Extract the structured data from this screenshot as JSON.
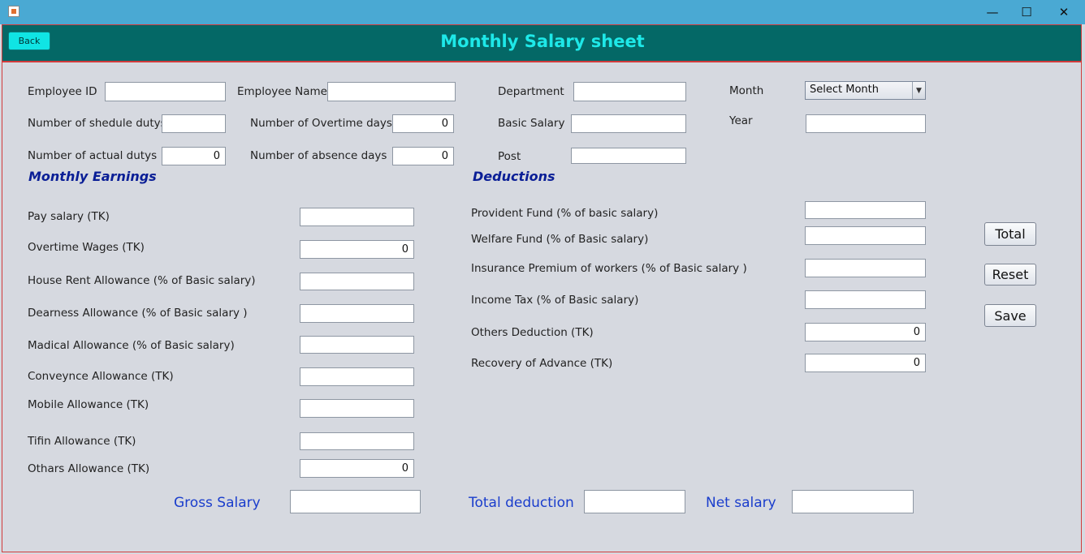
{
  "window": {
    "minimize_glyph": "—",
    "maximize_glyph": "☐",
    "close_glyph": "✕"
  },
  "header": {
    "back_label": "Back",
    "title": "Monthly Salary sheet"
  },
  "employee": {
    "employee_id": {
      "label": "Employee ID",
      "value": ""
    },
    "employee_name": {
      "label": "Employee Name",
      "value": ""
    },
    "department": {
      "label": "Department",
      "value": ""
    },
    "month": {
      "label": "Month",
      "selected": "Select Month"
    },
    "schedule_duties": {
      "label": "Number of shedule dutys",
      "value": ""
    },
    "overtime_days": {
      "label": "Number of Overtime days",
      "value": "0"
    },
    "basic_salary": {
      "label": "Basic Salary",
      "value": ""
    },
    "year": {
      "label": "Year",
      "value": ""
    },
    "actual_duties": {
      "label": "Number of actual dutys",
      "value": "0"
    },
    "absence_days": {
      "label": "Number of absence days",
      "value": "0"
    },
    "post": {
      "label": "Post",
      "value": ""
    }
  },
  "earnings": {
    "title": "Monthly Earnings",
    "items": [
      {
        "label": "Pay salary (TK)",
        "value": ""
      },
      {
        "label": "Overtime Wages (TK)",
        "value": "0"
      },
      {
        "label": "House Rent Allowance (% of Basic salary)",
        "value": ""
      },
      {
        "label": "Dearness Allowance (% of Basic salary )",
        "value": ""
      },
      {
        "label": "Madical Allowance (% of Basic salary)",
        "value": ""
      },
      {
        "label": "Conveynce Allowance (TK)",
        "value": ""
      },
      {
        "label": "Mobile Allowance (TK)",
        "value": ""
      },
      {
        "label": "Tifin Allowance (TK)",
        "value": ""
      },
      {
        "label": "Othars Allowance (TK)",
        "value": "0"
      }
    ]
  },
  "deductions": {
    "title": "Deductions",
    "items": [
      {
        "label": "Provident Fund (% of basic salary)",
        "value": ""
      },
      {
        "label": "Welfare Fund (% of Basic salary)",
        "value": ""
      },
      {
        "label": "Insurance Premium of workers (% of Basic salary )",
        "value": ""
      },
      {
        "label": "Income Tax (% of Basic salary)",
        "value": ""
      },
      {
        "label": "Others Deduction (TK)",
        "value": "0"
      },
      {
        "label": "Recovery of Advance (TK)",
        "value": "0"
      }
    ]
  },
  "actions": {
    "total_label": "Total",
    "reset_label": "Reset",
    "save_label": "Save"
  },
  "totals": {
    "gross_label": "Gross Salary",
    "gross_value": "",
    "deduction_label": "Total deduction",
    "deduction_value": "",
    "net_label": "Net salary",
    "net_value": ""
  },
  "colors": {
    "titlebar": "#4aa9d3",
    "header": "#046866",
    "title_text": "#1ee8e8",
    "back_button": "#10e4e4",
    "section_title": "#0a1e96",
    "totals_label": "#1a3dcc",
    "background": "#d6d9e0"
  }
}
